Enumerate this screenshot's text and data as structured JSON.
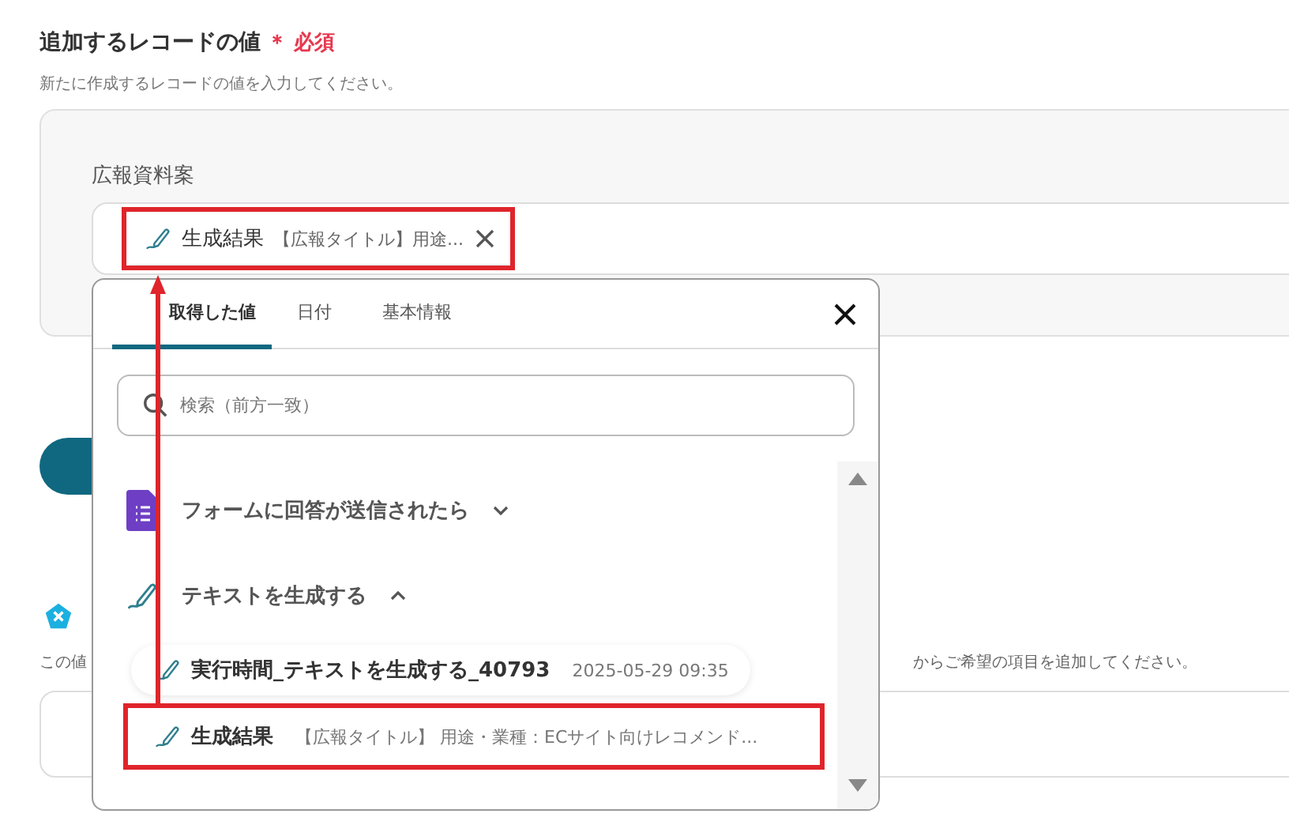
{
  "section": {
    "title": "追加するレコードの値",
    "required_mark": "＊",
    "required_label": "必須",
    "description": "新たに作成するレコードの値を入力してください。"
  },
  "field": {
    "label": "広報資料案",
    "chip": {
      "name": "生成結果",
      "preview": "【広報タイトル】用途...",
      "highlighted": true
    }
  },
  "lower_section": {
    "description_left": "この値",
    "description_right": "からご希望の項目を追加してください。"
  },
  "popup": {
    "tabs": [
      {
        "label": "取得した値",
        "selected": true
      },
      {
        "label": "日付",
        "selected": false
      },
      {
        "label": "基本情報",
        "selected": false
      }
    ],
    "search": {
      "placeholder": "検索（前方一致）"
    },
    "groups": [
      {
        "title": "フォームに回答が送信されたら",
        "kind": "form",
        "expanded": false
      },
      {
        "title": "テキストを生成する",
        "kind": "text",
        "expanded": true,
        "children": [
          {
            "name": "実行時間_テキストを生成する_40793",
            "value": "2025-05-29 09:35",
            "highlighted": false
          },
          {
            "name": "生成結果",
            "value": "【広報タイトル】 用途・業種：ECサイト向けレコメンド...",
            "highlighted": true
          }
        ]
      }
    ]
  }
}
